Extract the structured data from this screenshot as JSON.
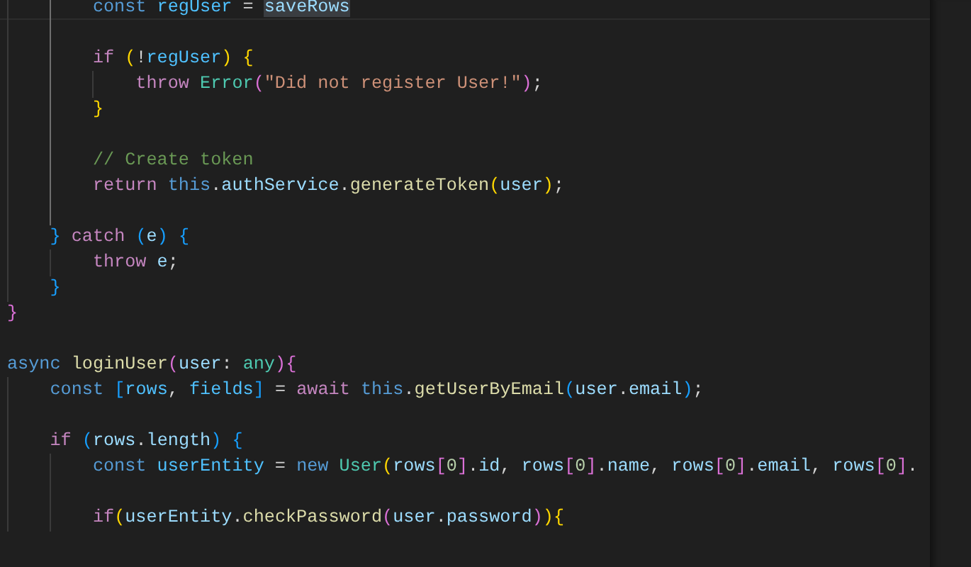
{
  "editor": {
    "lines": [
      {
        "guides": [
          {
            "active": false
          },
          {
            "active": true
          }
        ],
        "current": true,
        "tokens": [
          {
            "text": "const ",
            "kind": "keyword"
          },
          {
            "text": "regUser",
            "kind": "constant"
          },
          {
            "text": " = ",
            "kind": "plain"
          },
          {
            "text": "saveRows",
            "kind": "variable",
            "highlighted": true
          }
        ]
      },
      {
        "guides": [
          {
            "active": false
          },
          {
            "active": true
          }
        ]
      },
      {
        "guides": [
          {
            "active": false
          },
          {
            "active": true
          }
        ],
        "tokens": [
          {
            "text": "if ",
            "kind": "control"
          },
          {
            "text": "(",
            "kind": "bracket1"
          },
          {
            "text": "!",
            "kind": "plain"
          },
          {
            "text": "regUser",
            "kind": "constant"
          },
          {
            "text": ") ",
            "kind": "bracket1"
          },
          {
            "text": "{",
            "kind": "bracket1"
          }
        ]
      },
      {
        "guides": [
          {
            "active": false
          },
          {
            "active": true
          },
          {
            "active": false
          }
        ],
        "tokens": [
          {
            "text": "throw ",
            "kind": "control"
          },
          {
            "text": "Error",
            "kind": "type"
          },
          {
            "text": "(",
            "kind": "bracket2"
          },
          {
            "text": "\"Did not register User!\"",
            "kind": "string"
          },
          {
            "text": ")",
            "kind": "bracket2"
          },
          {
            "text": ";",
            "kind": "plain"
          }
        ]
      },
      {
        "guides": [
          {
            "active": false
          },
          {
            "active": true
          }
        ],
        "tokens": [
          {
            "text": "}",
            "kind": "bracket1"
          }
        ]
      },
      {
        "guides": [
          {
            "active": false
          },
          {
            "active": true
          }
        ]
      },
      {
        "guides": [
          {
            "active": false
          },
          {
            "active": true
          }
        ],
        "tokens": [
          {
            "text": "// Create token",
            "kind": "comment"
          }
        ]
      },
      {
        "guides": [
          {
            "active": false
          },
          {
            "active": true
          }
        ],
        "tokens": [
          {
            "text": "return ",
            "kind": "control"
          },
          {
            "text": "this",
            "kind": "keyword"
          },
          {
            "text": ".",
            "kind": "plain"
          },
          {
            "text": "authService",
            "kind": "variable"
          },
          {
            "text": ".",
            "kind": "plain"
          },
          {
            "text": "generateToken",
            "kind": "function"
          },
          {
            "text": "(",
            "kind": "bracket1"
          },
          {
            "text": "user",
            "kind": "variable"
          },
          {
            "text": ")",
            "kind": "bracket1"
          },
          {
            "text": ";",
            "kind": "plain"
          }
        ]
      },
      {
        "guides": [
          {
            "active": false
          },
          {
            "active": true
          }
        ]
      },
      {
        "guides": [
          {
            "active": false
          }
        ],
        "tokens": [
          {
            "text": "} ",
            "kind": "bracket3"
          },
          {
            "text": "catch ",
            "kind": "control"
          },
          {
            "text": "(",
            "kind": "bracket3"
          },
          {
            "text": "e",
            "kind": "variable"
          },
          {
            "text": ") ",
            "kind": "bracket3"
          },
          {
            "text": "{",
            "kind": "bracket3"
          }
        ]
      },
      {
        "guides": [
          {
            "active": false
          },
          {
            "active": false
          }
        ],
        "tokens": [
          {
            "text": "throw ",
            "kind": "control"
          },
          {
            "text": "e",
            "kind": "variable"
          },
          {
            "text": ";",
            "kind": "plain"
          }
        ]
      },
      {
        "guides": [
          {
            "active": false
          }
        ],
        "tokens": [
          {
            "text": "}",
            "kind": "bracket3"
          }
        ]
      },
      {
        "tokens": [
          {
            "text": "}",
            "kind": "bracket2"
          }
        ]
      },
      {
        "kind": "blank"
      },
      {
        "tokens": [
          {
            "text": "async ",
            "kind": "keyword"
          },
          {
            "text": "loginUser",
            "kind": "function"
          },
          {
            "text": "(",
            "kind": "bracket2"
          },
          {
            "text": "user",
            "kind": "variable"
          },
          {
            "text": ": ",
            "kind": "plain"
          },
          {
            "text": "any",
            "kind": "type"
          },
          {
            "text": ")",
            "kind": "bracket2"
          },
          {
            "text": "{",
            "kind": "bracket2"
          }
        ]
      },
      {
        "guides": [
          {
            "active": false
          }
        ],
        "tokens": [
          {
            "text": "const ",
            "kind": "keyword"
          },
          {
            "text": "[",
            "kind": "bracket3"
          },
          {
            "text": "rows",
            "kind": "constant"
          },
          {
            "text": ", ",
            "kind": "plain"
          },
          {
            "text": "fields",
            "kind": "constant"
          },
          {
            "text": "]",
            "kind": "bracket3"
          },
          {
            "text": " = ",
            "kind": "plain"
          },
          {
            "text": "await ",
            "kind": "control"
          },
          {
            "text": "this",
            "kind": "keyword"
          },
          {
            "text": ".",
            "kind": "plain"
          },
          {
            "text": "getUserByEmail",
            "kind": "function"
          },
          {
            "text": "(",
            "kind": "bracket3"
          },
          {
            "text": "user",
            "kind": "variable"
          },
          {
            "text": ".",
            "kind": "plain"
          },
          {
            "text": "email",
            "kind": "variable"
          },
          {
            "text": ")",
            "kind": "bracket3"
          },
          {
            "text": ";",
            "kind": "plain"
          }
        ]
      },
      {
        "guides": [
          {
            "active": false
          }
        ]
      },
      {
        "guides": [
          {
            "active": false
          }
        ],
        "tokens": [
          {
            "text": "if ",
            "kind": "control"
          },
          {
            "text": "(",
            "kind": "bracket3"
          },
          {
            "text": "rows",
            "kind": "variable"
          },
          {
            "text": ".",
            "kind": "plain"
          },
          {
            "text": "length",
            "kind": "variable"
          },
          {
            "text": ") ",
            "kind": "bracket3"
          },
          {
            "text": "{",
            "kind": "bracket3"
          }
        ]
      },
      {
        "guides": [
          {
            "active": false
          },
          {
            "active": false
          }
        ],
        "tokens": [
          {
            "text": "const ",
            "kind": "keyword"
          },
          {
            "text": "userEntity",
            "kind": "constant"
          },
          {
            "text": " = ",
            "kind": "plain"
          },
          {
            "text": "new ",
            "kind": "keyword"
          },
          {
            "text": "User",
            "kind": "type"
          },
          {
            "text": "(",
            "kind": "bracket1"
          },
          {
            "text": "rows",
            "kind": "variable"
          },
          {
            "text": "[",
            "kind": "bracket2"
          },
          {
            "text": "0",
            "kind": "number"
          },
          {
            "text": "]",
            "kind": "bracket2"
          },
          {
            "text": ".",
            "kind": "plain"
          },
          {
            "text": "id",
            "kind": "variable"
          },
          {
            "text": ", ",
            "kind": "plain"
          },
          {
            "text": "rows",
            "kind": "variable"
          },
          {
            "text": "[",
            "kind": "bracket2"
          },
          {
            "text": "0",
            "kind": "number"
          },
          {
            "text": "]",
            "kind": "bracket2"
          },
          {
            "text": ".",
            "kind": "plain"
          },
          {
            "text": "name",
            "kind": "variable"
          },
          {
            "text": ", ",
            "kind": "plain"
          },
          {
            "text": "rows",
            "kind": "variable"
          },
          {
            "text": "[",
            "kind": "bracket2"
          },
          {
            "text": "0",
            "kind": "number"
          },
          {
            "text": "]",
            "kind": "bracket2"
          },
          {
            "text": ".",
            "kind": "plain"
          },
          {
            "text": "email",
            "kind": "variable"
          },
          {
            "text": ", ",
            "kind": "plain"
          },
          {
            "text": "rows",
            "kind": "variable"
          },
          {
            "text": "[",
            "kind": "bracket2"
          },
          {
            "text": "0",
            "kind": "number"
          },
          {
            "text": "]",
            "kind": "bracket2"
          },
          {
            "text": ".",
            "kind": "plain"
          }
        ]
      },
      {
        "guides": [
          {
            "active": false
          },
          {
            "active": false
          }
        ]
      },
      {
        "guides": [
          {
            "active": false
          },
          {
            "active": false
          }
        ],
        "tokens": [
          {
            "text": "if",
            "kind": "control"
          },
          {
            "text": "(",
            "kind": "bracket1"
          },
          {
            "text": "userEntity",
            "kind": "variable"
          },
          {
            "text": ".",
            "kind": "plain"
          },
          {
            "text": "checkPassword",
            "kind": "function"
          },
          {
            "text": "(",
            "kind": "bracket2"
          },
          {
            "text": "user",
            "kind": "variable"
          },
          {
            "text": ".",
            "kind": "plain"
          },
          {
            "text": "password",
            "kind": "variable"
          },
          {
            "text": ")",
            "kind": "bracket2"
          },
          {
            "text": ")",
            "kind": "bracket1"
          },
          {
            "text": "{",
            "kind": "bracket1"
          }
        ]
      }
    ]
  }
}
